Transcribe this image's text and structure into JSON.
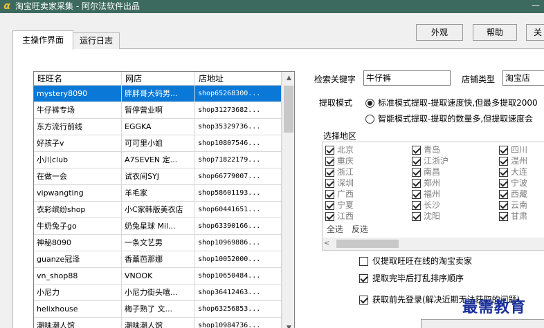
{
  "window": {
    "title": "淘宝旺卖家采集 - 阿尔法软件出品",
    "app_icon": "α",
    "minimize": "—"
  },
  "top_buttons": {
    "appearance": "外观",
    "help": "帮助",
    "close_partial": "关"
  },
  "tabs": [
    {
      "label": "主操作界面"
    },
    {
      "label": "运行日志"
    }
  ],
  "grid": {
    "columns": [
      "旺旺名",
      "网店",
      "店地址"
    ],
    "rows": [
      [
        "mystery8090",
        "胖胖哥大码男...",
        "shop65268300..."
      ],
      [
        "牛仔裤专场",
        "暂停营业啊",
        "shop31273682..."
      ],
      [
        "东方流行前线",
        "EGGKA",
        "shop35329736..."
      ],
      [
        "好孩子v",
        "可可里小姐",
        "shop10807546..."
      ],
      [
        "小川club",
        "A7SEVEN  定...",
        "shop71822179..."
      ],
      [
        "在做一会",
        "试衣间SYJ",
        "shop66779007..."
      ],
      [
        "vipwangting",
        "羊毛家",
        "shop58601193..."
      ],
      [
        "衣彩缤纷shop",
        "小C家韩版美衣店",
        "shop60441651..."
      ],
      [
        "牛奶兔子go",
        "奶兔星球 Mil...",
        "shop63390166..."
      ],
      [
        "神秘8090",
        "一条文艺男",
        "shop10969886..."
      ],
      [
        "guanze冠泽",
        "香薰芭那娜",
        "shop10052000..."
      ],
      [
        "vn_shop88",
        "VNOOK",
        "shop10650484..."
      ],
      [
        "小尼力",
        "小尼力街头嘻...",
        "shop36412463..."
      ],
      [
        "helixhouse",
        "梅子熟了 文...",
        "shop63256853..."
      ],
      [
        "潮味潮人馆",
        "潮味潮人馆",
        "shop10984736..."
      ]
    ]
  },
  "search": {
    "keyword_label": "检索关键字",
    "keyword_value": "牛仔裤",
    "type_label": "店铺类型",
    "type_value": "淘宝店"
  },
  "extract_mode": {
    "label": "提取模式",
    "options": [
      {
        "label": "标准模式提取-提取速度快,但最多提取2000",
        "selected": true
      },
      {
        "label": "智能模式提取-提取的数量多,但提取速度会",
        "selected": false
      }
    ]
  },
  "region": {
    "label": "选择地区",
    "items": [
      "北京",
      "青岛",
      "四川",
      "重庆",
      "江浙沪",
      "温州",
      "浙江",
      "南昌",
      "大连",
      "深圳",
      "郑州",
      "宁波",
      "广西",
      "福州",
      "西藏",
      "宁夏",
      "长沙",
      "云南",
      "江西",
      "沈阳",
      "甘肃"
    ],
    "select_all": "全选",
    "invert": "反选"
  },
  "options": {
    "online_only": "仅提取旺旺在线的淘宝卖家",
    "shuffle": "提取完毕后打乱排序顺序",
    "login_first": "获取前先登录(解决近期无法获取的问题)"
  },
  "watermark": "最需教育"
}
